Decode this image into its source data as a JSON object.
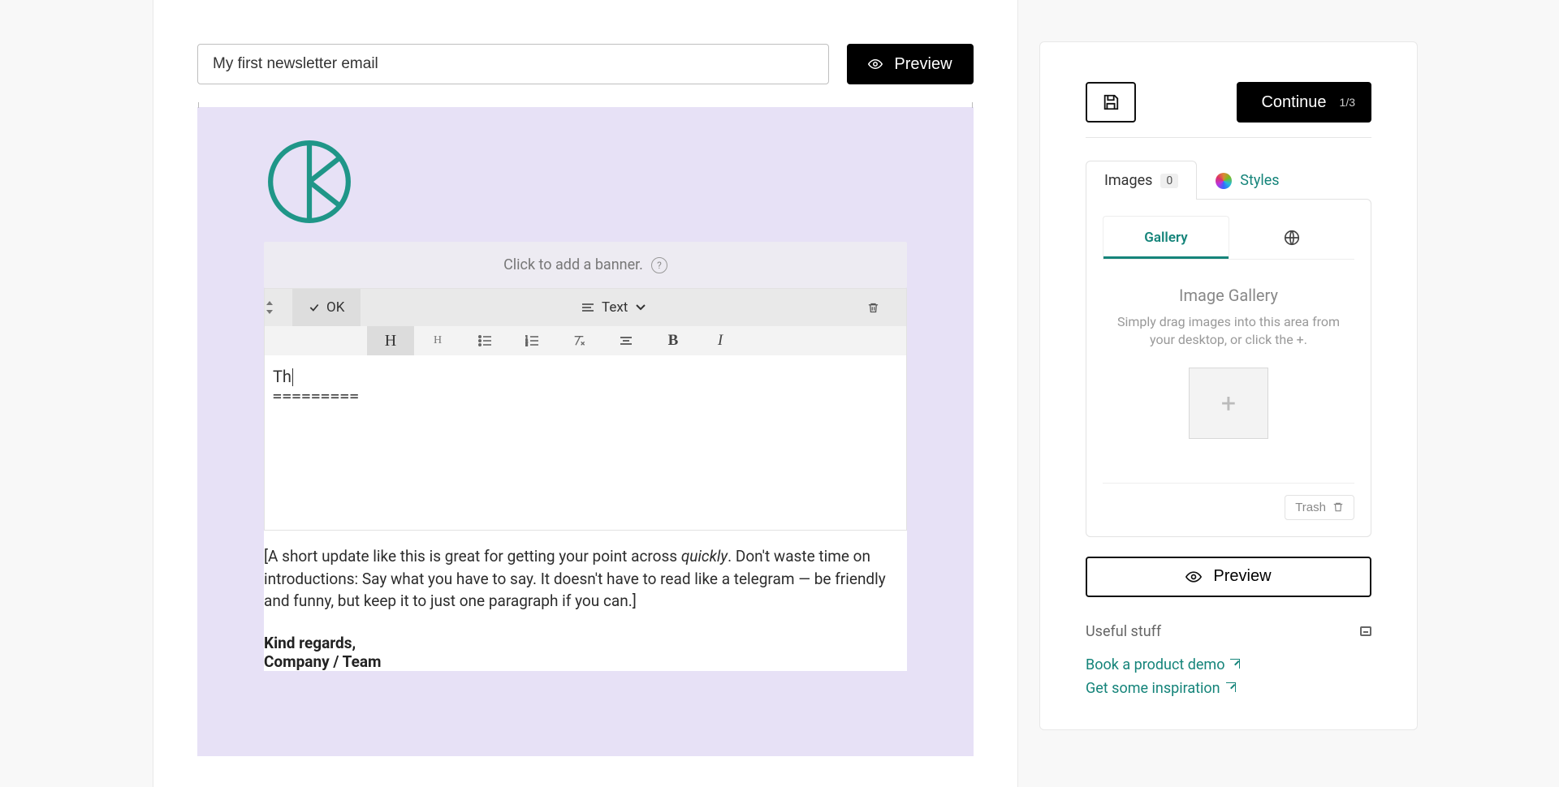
{
  "header": {
    "subject_value": "My first newsletter email",
    "preview_label": "Preview"
  },
  "canvas": {
    "banner_prompt": "Click to add a banner.",
    "block": {
      "ok_label": "OK",
      "type_label": "Text",
      "heading_text": "Th",
      "underline": "========="
    },
    "paragraph_lead": "[A short update like this is great for getting your point across ",
    "paragraph_quickly": "quickly",
    "paragraph_rest": ". Don't waste time on introductions: Say what you have to say. It doesn't have to read like a telegram — be friendly and funny, but keep it to just one paragraph if you can.]",
    "signoff1": "Kind regards,",
    "signoff2": "Company / Team"
  },
  "right": {
    "continue_label": "Continue",
    "step_indicator": "1/3",
    "tabs": {
      "images_label": "Images",
      "images_count": "0",
      "styles_label": "Styles"
    },
    "subtabs": {
      "gallery_label": "Gallery"
    },
    "gallery": {
      "title": "Image Gallery",
      "desc": "Simply drag images into this area from your desktop, or click the +.",
      "trash_label": "Trash"
    },
    "preview_label": "Preview",
    "useful_label": "Useful stuff",
    "links": {
      "demo": "Book a product demo",
      "inspiration": "Get some inspiration"
    }
  }
}
